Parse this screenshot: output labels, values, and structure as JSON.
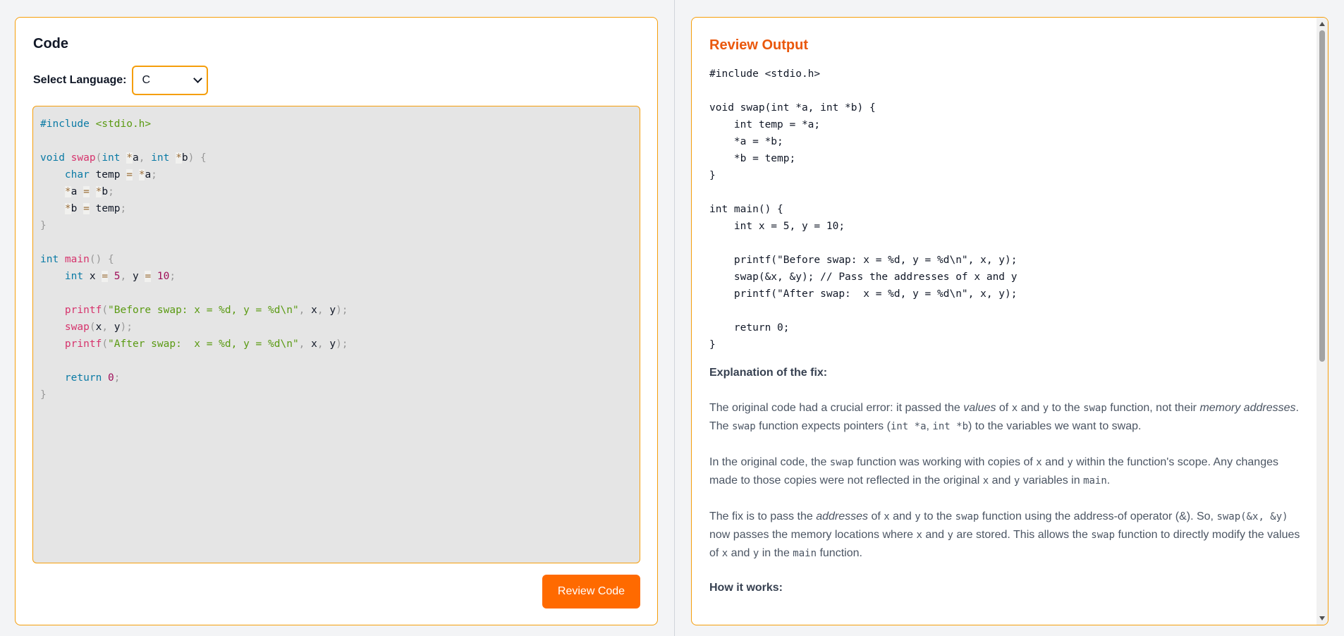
{
  "left_panel": {
    "title": "Code",
    "language_label": "Select Language:",
    "language_selected": "C",
    "review_button": "Review Code",
    "code_lines": [
      [
        {
          "t": "#include ",
          "c": "pre"
        },
        {
          "t": "<stdio.h>",
          "c": "str"
        }
      ],
      [],
      [
        {
          "t": "void ",
          "c": "kw"
        },
        {
          "t": "swap",
          "c": "fn"
        },
        {
          "t": "(",
          "c": "p"
        },
        {
          "t": "int ",
          "c": "kw"
        },
        {
          "t": "*",
          "c": "op"
        },
        {
          "t": "a",
          "c": ""
        },
        {
          "t": ", ",
          "c": "p"
        },
        {
          "t": "int ",
          "c": "kw"
        },
        {
          "t": "*",
          "c": "op"
        },
        {
          "t": "b",
          "c": ""
        },
        {
          "t": ") {",
          "c": "p"
        }
      ],
      [
        {
          "t": "    ",
          "c": ""
        },
        {
          "t": "char ",
          "c": "kw"
        },
        {
          "t": "temp ",
          "c": ""
        },
        {
          "t": "=",
          "c": "op"
        },
        {
          "t": " ",
          "c": ""
        },
        {
          "t": "*",
          "c": "op"
        },
        {
          "t": "a",
          "c": ""
        },
        {
          "t": ";",
          "c": "p"
        }
      ],
      [
        {
          "t": "    ",
          "c": ""
        },
        {
          "t": "*",
          "c": "op"
        },
        {
          "t": "a ",
          "c": ""
        },
        {
          "t": "=",
          "c": "op"
        },
        {
          "t": " ",
          "c": ""
        },
        {
          "t": "*",
          "c": "op"
        },
        {
          "t": "b",
          "c": ""
        },
        {
          "t": ";",
          "c": "p"
        }
      ],
      [
        {
          "t": "    ",
          "c": ""
        },
        {
          "t": "*",
          "c": "op"
        },
        {
          "t": "b ",
          "c": ""
        },
        {
          "t": "=",
          "c": "op"
        },
        {
          "t": " temp",
          "c": ""
        },
        {
          "t": ";",
          "c": "p"
        }
      ],
      [
        {
          "t": "}",
          "c": "p"
        }
      ],
      [],
      [
        {
          "t": "int ",
          "c": "kw"
        },
        {
          "t": "main",
          "c": "fn"
        },
        {
          "t": "() {",
          "c": "p"
        }
      ],
      [
        {
          "t": "    ",
          "c": ""
        },
        {
          "t": "int ",
          "c": "kw"
        },
        {
          "t": "x ",
          "c": ""
        },
        {
          "t": "=",
          "c": "op"
        },
        {
          "t": " ",
          "c": ""
        },
        {
          "t": "5",
          "c": "num"
        },
        {
          "t": ", ",
          "c": "p"
        },
        {
          "t": "y ",
          "c": ""
        },
        {
          "t": "=",
          "c": "op"
        },
        {
          "t": " ",
          "c": ""
        },
        {
          "t": "10",
          "c": "num"
        },
        {
          "t": ";",
          "c": "p"
        }
      ],
      [],
      [
        {
          "t": "    ",
          "c": ""
        },
        {
          "t": "printf",
          "c": "fn"
        },
        {
          "t": "(",
          "c": "p"
        },
        {
          "t": "\"Before swap: x = %d, y = %d\\n\"",
          "c": "str"
        },
        {
          "t": ", ",
          "c": "p"
        },
        {
          "t": "x",
          "c": ""
        },
        {
          "t": ", ",
          "c": "p"
        },
        {
          "t": "y",
          "c": ""
        },
        {
          "t": ");",
          "c": "p"
        }
      ],
      [
        {
          "t": "    ",
          "c": ""
        },
        {
          "t": "swap",
          "c": "fn"
        },
        {
          "t": "(",
          "c": "p"
        },
        {
          "t": "x",
          "c": ""
        },
        {
          "t": ", ",
          "c": "p"
        },
        {
          "t": "y",
          "c": ""
        },
        {
          "t": ");",
          "c": "p"
        }
      ],
      [
        {
          "t": "    ",
          "c": ""
        },
        {
          "t": "printf",
          "c": "fn"
        },
        {
          "t": "(",
          "c": "p"
        },
        {
          "t": "\"After swap:  x = %d, y = %d\\n\"",
          "c": "str"
        },
        {
          "t": ", ",
          "c": "p"
        },
        {
          "t": "x",
          "c": ""
        },
        {
          "t": ", ",
          "c": "p"
        },
        {
          "t": "y",
          "c": ""
        },
        {
          "t": ");",
          "c": "p"
        }
      ],
      [],
      [
        {
          "t": "    ",
          "c": ""
        },
        {
          "t": "return ",
          "c": "kw"
        },
        {
          "t": "0",
          "c": "num"
        },
        {
          "t": ";",
          "c": "p"
        }
      ],
      [
        {
          "t": "}",
          "c": "p"
        }
      ]
    ]
  },
  "right_panel": {
    "title": "Review Output",
    "code_lines": [
      "#include <stdio.h>",
      "",
      "void swap(int *a, int *b) {",
      "    int temp = *a;",
      "    *a = *b;",
      "    *b = temp;",
      "}",
      "",
      "int main() {",
      "    int x = 5, y = 10;",
      "",
      "    printf(\"Before swap: x = %d, y = %d\\n\", x, y);",
      "    swap(&x, &y); // Pass the addresses of x and y",
      "    printf(\"After swap:  x = %d, y = %d\\n\", x, y);",
      "",
      "    return 0;",
      "}"
    ],
    "explanation_heading": "Explanation of the fix:",
    "paragraphs": [
      [
        {
          "t": "The original code had a crucial error: it passed the ",
          "s": ""
        },
        {
          "t": "values",
          "s": "i"
        },
        {
          "t": " of ",
          "s": ""
        },
        {
          "t": "x",
          "s": "m"
        },
        {
          "t": " and ",
          "s": ""
        },
        {
          "t": "y",
          "s": "m"
        },
        {
          "t": " to the ",
          "s": ""
        },
        {
          "t": "swap",
          "s": "m"
        },
        {
          "t": " function, not their ",
          "s": ""
        },
        {
          "t": "memory addresses",
          "s": "i"
        },
        {
          "t": ".  The ",
          "s": ""
        },
        {
          "t": "swap",
          "s": "m"
        },
        {
          "t": " function expects pointers (",
          "s": ""
        },
        {
          "t": "int *a",
          "s": "m"
        },
        {
          "t": ", ",
          "s": ""
        },
        {
          "t": "int *b",
          "s": "m"
        },
        {
          "t": ") to the variables we want to swap.",
          "s": ""
        }
      ],
      [
        {
          "t": "In the original code, the ",
          "s": ""
        },
        {
          "t": "swap",
          "s": "m"
        },
        {
          "t": " function was working with copies of ",
          "s": ""
        },
        {
          "t": "x",
          "s": "m"
        },
        {
          "t": " and ",
          "s": ""
        },
        {
          "t": "y",
          "s": "m"
        },
        {
          "t": " within the function's scope.  Any changes made to those copies were not reflected in the original ",
          "s": ""
        },
        {
          "t": "x",
          "s": "m"
        },
        {
          "t": " and ",
          "s": ""
        },
        {
          "t": "y",
          "s": "m"
        },
        {
          "t": " variables in ",
          "s": ""
        },
        {
          "t": "main",
          "s": "m"
        },
        {
          "t": ".",
          "s": ""
        }
      ],
      [
        {
          "t": "The fix is to pass the ",
          "s": ""
        },
        {
          "t": "addresses",
          "s": "i"
        },
        {
          "t": " of ",
          "s": ""
        },
        {
          "t": "x",
          "s": "m"
        },
        {
          "t": " and ",
          "s": ""
        },
        {
          "t": "y",
          "s": "m"
        },
        {
          "t": " to the ",
          "s": ""
        },
        {
          "t": "swap",
          "s": "m"
        },
        {
          "t": " function using the address-of operator (&).  So, ",
          "s": ""
        },
        {
          "t": "swap(&x, &y)",
          "s": "m"
        },
        {
          "t": " now passes the memory locations where ",
          "s": ""
        },
        {
          "t": "x",
          "s": "m"
        },
        {
          "t": " and ",
          "s": ""
        },
        {
          "t": "y",
          "s": "m"
        },
        {
          "t": " are stored.  This allows the ",
          "s": ""
        },
        {
          "t": "swap",
          "s": "m"
        },
        {
          "t": " function to directly modify the values of ",
          "s": ""
        },
        {
          "t": "x",
          "s": "m"
        },
        {
          "t": " and ",
          "s": ""
        },
        {
          "t": "y",
          "s": "m"
        },
        {
          "t": " in the ",
          "s": ""
        },
        {
          "t": "main",
          "s": "m"
        },
        {
          "t": " function.",
          "s": ""
        }
      ]
    ],
    "how_heading": "How it works:"
  },
  "colors": {
    "accent": "#f59e0b",
    "button": "#ff6a00",
    "title_accent": "#ea580c",
    "editor_bg": "#e5e5e5"
  }
}
